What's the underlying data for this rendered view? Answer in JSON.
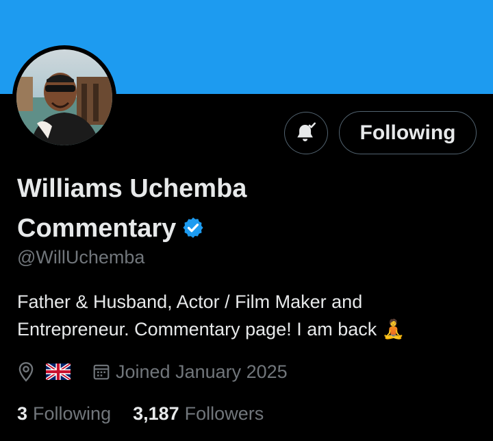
{
  "profile": {
    "name_line1": "Williams Uchemba",
    "name_line2": "Commentary",
    "handle": "@WillUchemba",
    "bio_line1": "Father & Husband, Actor / Film Maker and",
    "bio_line2": "Entrepreneur. Commentary page! I am back 🧘",
    "location_icon": "map-pin-icon",
    "location_flag": "🇬🇧",
    "joined": "Joined January 2025",
    "verified_icon": "verified-badge-icon"
  },
  "actions": {
    "notify_icon": "bell-subscribed-icon",
    "follow_label": "Following"
  },
  "stats": {
    "following_count": "3",
    "following_label": "Following",
    "followers_count": "3,187",
    "followers_label": "Followers"
  },
  "colors": {
    "banner": "#1d9bf0",
    "background": "#000000",
    "primary_text": "#e7e9ea",
    "secondary_text": "#71767b",
    "verified": "#1d9bf0",
    "button_border": "#536471"
  }
}
